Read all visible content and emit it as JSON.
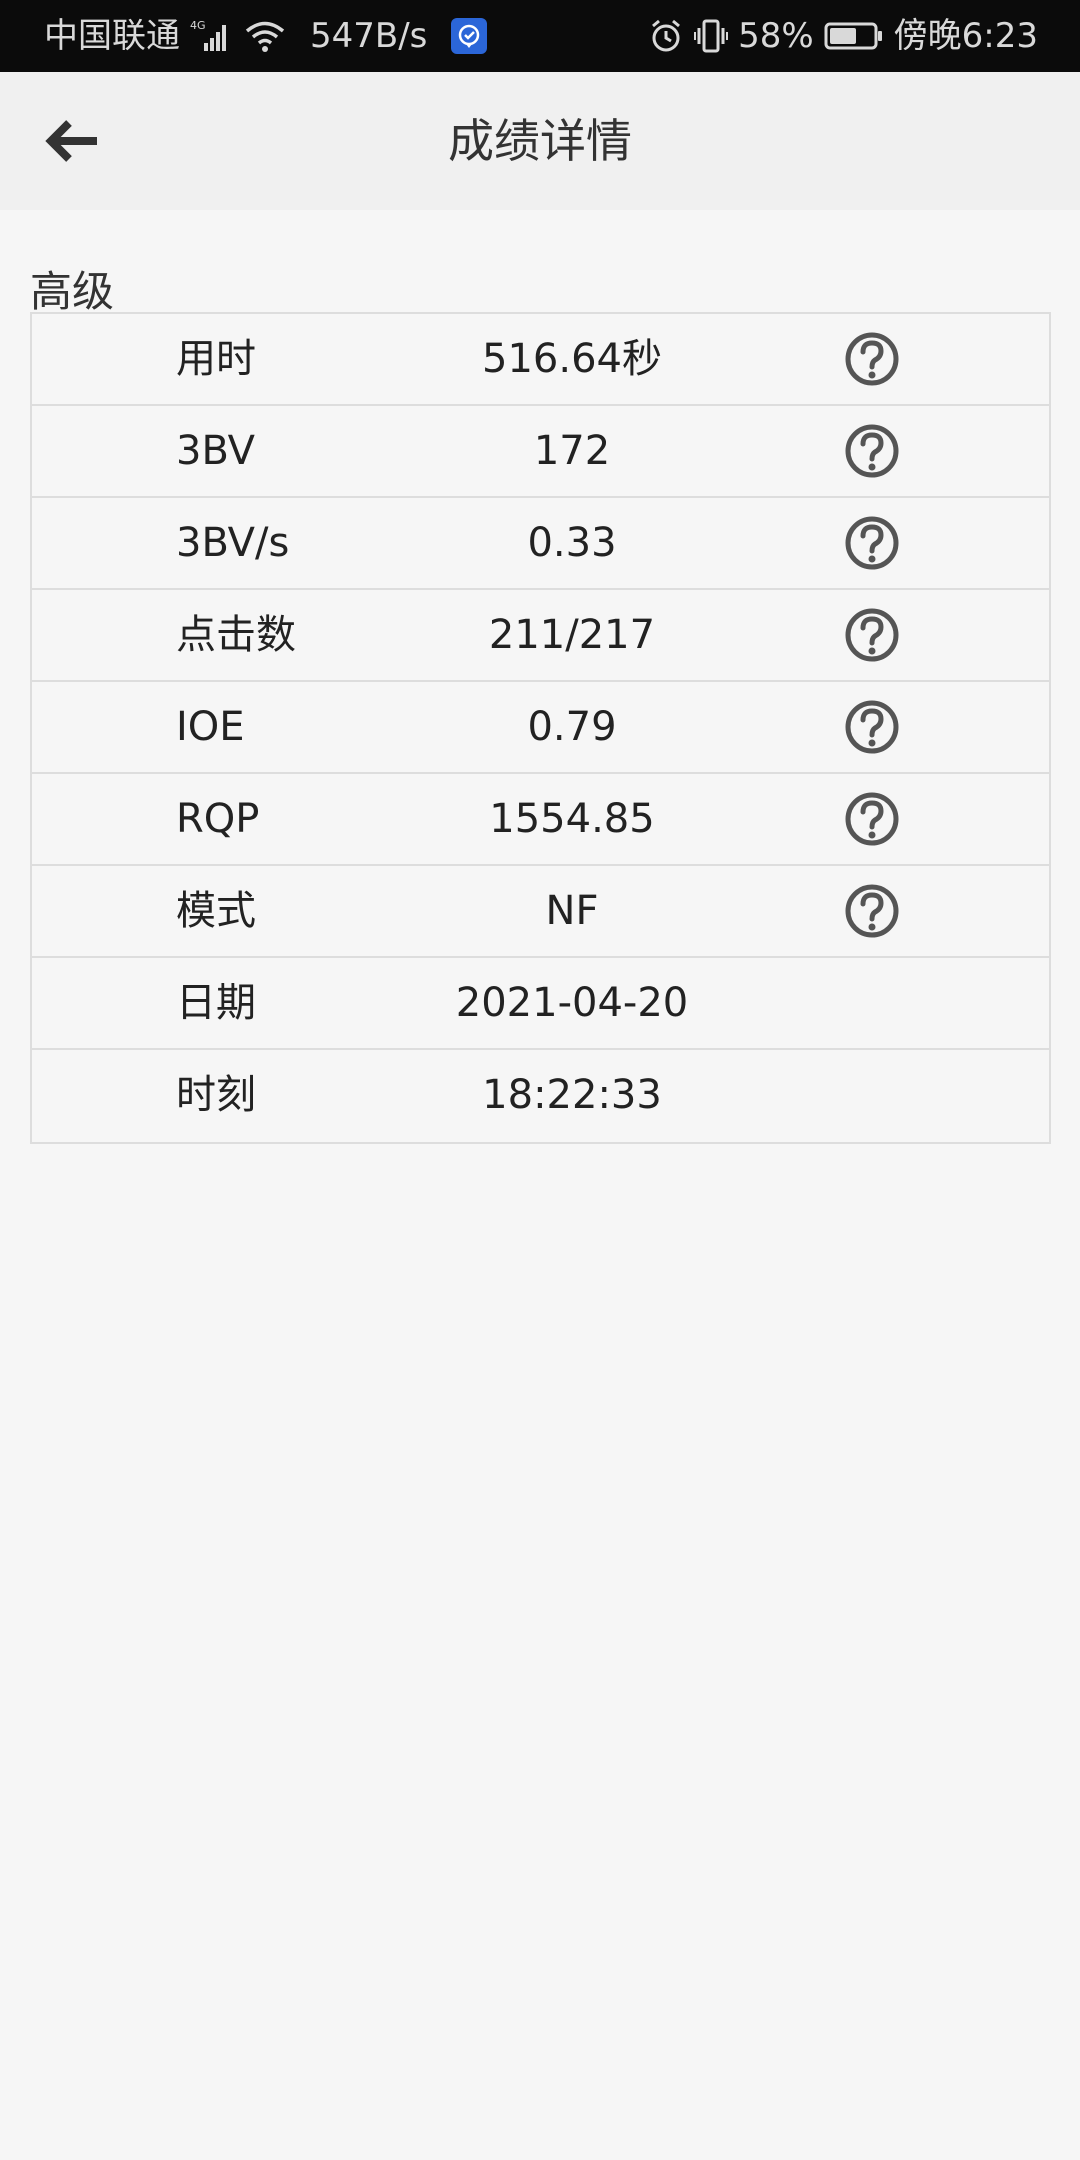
{
  "status_bar": {
    "carrier": "中国联通",
    "network_type": "4G",
    "net_speed": "547B/s",
    "battery": "58%",
    "time": "傍晚6:23"
  },
  "header": {
    "title": "成绩详情",
    "back_icon": "arrow-left-icon"
  },
  "section": {
    "label": "高级"
  },
  "rows": [
    {
      "label": "用时",
      "value": "516.64秒",
      "help": true
    },
    {
      "label": "3BV",
      "value": "172",
      "help": true
    },
    {
      "label": "3BV/s",
      "value": "0.33",
      "help": true
    },
    {
      "label": "点击数",
      "value": "211/217",
      "help": true
    },
    {
      "label": "IOE",
      "value": "0.79",
      "help": true
    },
    {
      "label": "RQP",
      "value": "1554.85",
      "help": true
    },
    {
      "label": "模式",
      "value": "NF",
      "help": true
    },
    {
      "label": "日期",
      "value": "2021-04-20",
      "help": false
    },
    {
      "label": "时刻",
      "value": "18:22:33",
      "help": false
    }
  ],
  "colors": {
    "status_bar_bg": "#0b0b0b",
    "app_bar_bg": "#f0f0f0",
    "page_bg": "#f6f6f6",
    "border": "#dddddd",
    "text": "#222222",
    "icon": "#555555",
    "app_badge": "#2b66d8"
  }
}
